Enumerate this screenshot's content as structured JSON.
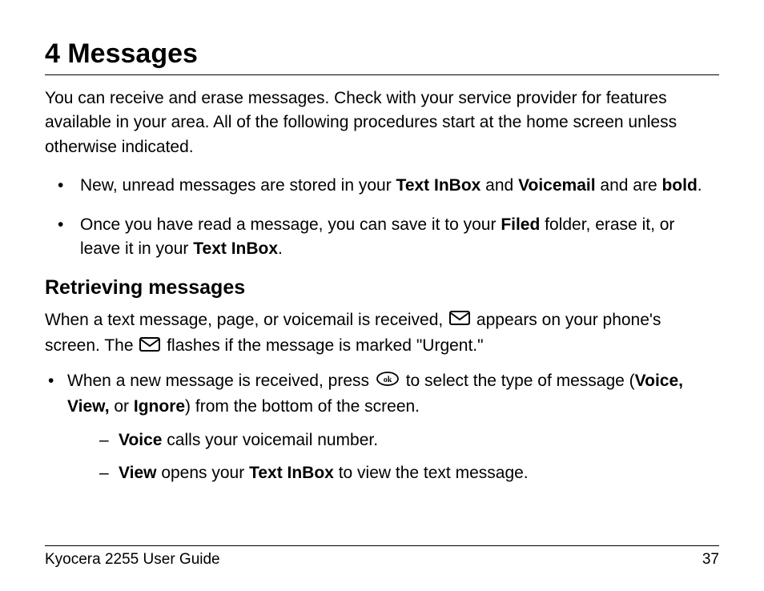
{
  "heading": "4 Messages",
  "intro": "You can receive and erase messages. Check with your service provider for features available in your area. All of the following procedures start at the home screen unless otherwise indicated.",
  "bullets": {
    "b1_pre": "New, unread messages are stored in your ",
    "b1_bold1": "Text InBox",
    "b1_mid1": " and ",
    "b1_bold2": "Voicemail",
    "b1_mid2": " and are ",
    "b1_bold3": "bold",
    "b1_post": ".",
    "b2_pre": "Once you have read a message, you can save it to your ",
    "b2_bold1": "Filed",
    "b2_mid1": " folder, erase it, or leave it in your ",
    "b2_bold2": "Text InBox",
    "b2_post": "."
  },
  "subheading": "Retrieving messages",
  "subintro": {
    "s1": "When a text message, page, or voicemail is received, ",
    "s2": " appears on your phone's screen. The ",
    "s3": " flashes if the message is marked \"Urgent.\""
  },
  "sublist": {
    "i1_pre": "When a new message is received, press ",
    "i1_mid": " to select the type of message (",
    "i1_bold": "Voice, View,",
    "i1_mid2": " or ",
    "i1_bold2": "Ignore",
    "i1_post": ") from the bottom of the screen."
  },
  "dash": {
    "d1_bold": "Voice",
    "d1_text": " calls your voicemail number.",
    "d2_bold": "View",
    "d2_mid": " opens your ",
    "d2_bold2": "Text InBox",
    "d2_post": " to view the text message."
  },
  "footer_left": "Kyocera 2255 User Guide",
  "footer_right": "37",
  "icons": {
    "envelope": "envelope-icon",
    "ok": "ok-button-icon"
  }
}
